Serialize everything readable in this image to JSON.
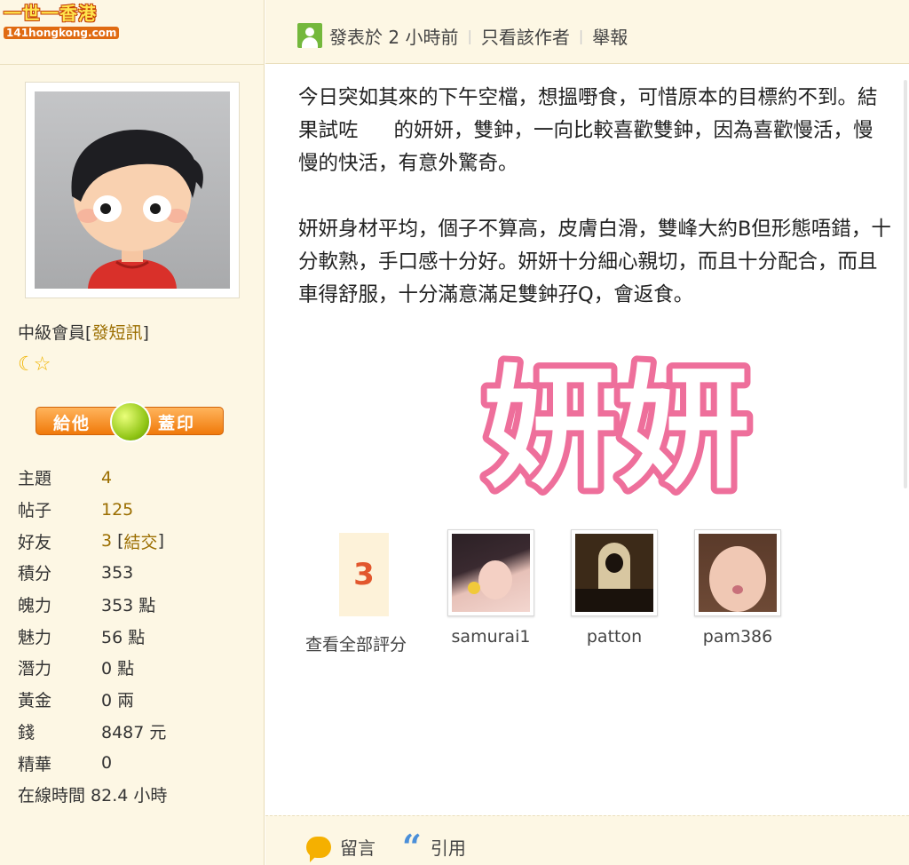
{
  "site": {
    "logo_cn": "一世一香港",
    "logo_en": "141hongkong.com"
  },
  "user": {
    "rank": "中級會員",
    "pm_link": "發短訊",
    "stamp_left": "給他",
    "stamp_right": "蓋印",
    "stats": [
      {
        "key": "主題",
        "value": "4"
      },
      {
        "key": "帖子",
        "value": "125"
      },
      {
        "key": "好友",
        "value": "3",
        "extra": "結交"
      },
      {
        "key": "積分",
        "value": "353"
      },
      {
        "key": "魄力",
        "value": "353 點"
      },
      {
        "key": "魅力",
        "value": "56 點"
      },
      {
        "key": "潛力",
        "value": "0 點"
      },
      {
        "key": "黃金",
        "value": "0 兩"
      },
      {
        "key": "錢",
        "value": "8487 元"
      },
      {
        "key": "精華",
        "value": "0"
      },
      {
        "key": "在線時間",
        "value": "82.4 小時"
      }
    ]
  },
  "post": {
    "posted": "發表於 2 小時前",
    "only_author": "只看該作者",
    "report": "舉報",
    "para1_a": "今日突如其來的下午空檔，想搵嘢食，可惜原本的目標約不到。結果試咗",
    "para1_b": "的妍妍，雙鈡，一向比較喜歡雙鈡，因為喜歡慢活，慢慢的快活，有意外驚奇。",
    "para2": "妍妍身材平均，個子不算高，皮膚白滑，雙峰大約B但形態唔錯，十分軟熟，手口感十分好。妍妍十分細心親切，而且十分配合，而且車得舒服，十分滿意滿足雙鈡孖Q，會返食。",
    "big_name": "妍妍"
  },
  "rating": {
    "count": "3",
    "view_all": "查看全部評分",
    "raters": [
      "samurai1",
      "patton",
      "pam386"
    ]
  },
  "footer": {
    "comment": "留言",
    "quote": "引用"
  },
  "colors": {
    "sidebar_bg": "#fdf7e4",
    "link": "#9b6e00",
    "accent_pink": "#ee6f9b",
    "rate_red": "#e2572d"
  }
}
